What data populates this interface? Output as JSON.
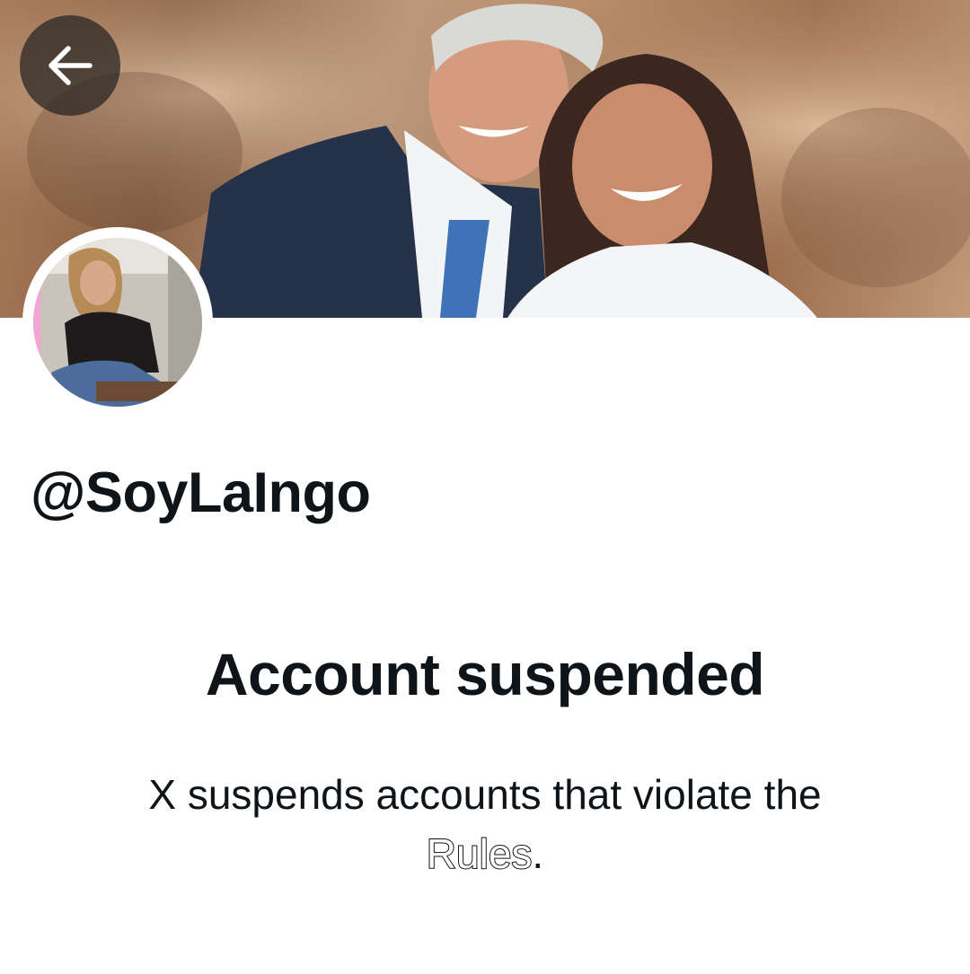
{
  "profile": {
    "handle": "@SoyLaIngo",
    "banner": {
      "description_icon": "banner-photo"
    },
    "avatar": {
      "icon": "profile-photo"
    }
  },
  "navigation": {
    "back_icon": "arrow-left-icon"
  },
  "suspension": {
    "title": "Account suspended",
    "message_prefix": "X suspends accounts that violate the ",
    "rules_link": "Rules",
    "message_suffix": "."
  },
  "colors": {
    "text": "#0f1419",
    "background": "#ffffff",
    "back_button_bg": "#262221"
  }
}
